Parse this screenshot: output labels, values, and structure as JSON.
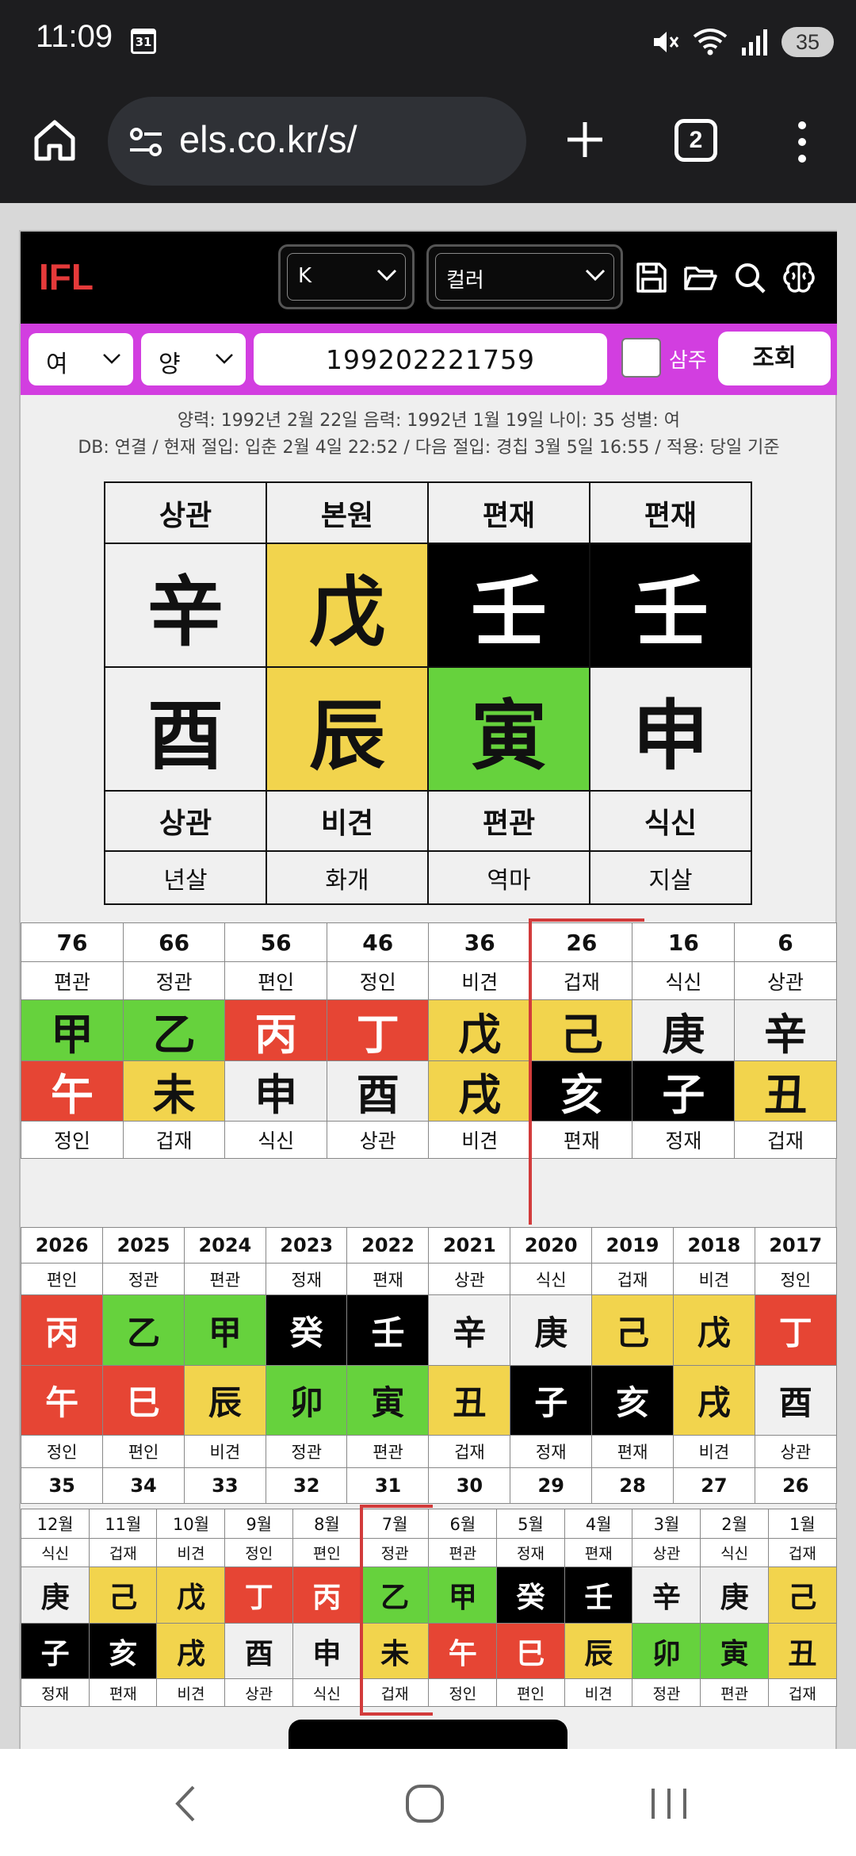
{
  "status": {
    "time": "11:09",
    "calendar_day": "31",
    "battery": "35"
  },
  "browser": {
    "url": "els.co.kr/s/",
    "tab_count": "2"
  },
  "app": {
    "logo": "IFL",
    "select_k": "K",
    "select_color": "컬러",
    "gender": "여",
    "calendar": "양",
    "birth_input": "199202221759",
    "saju_label": "삼주",
    "query_button": "조회",
    "info_line1": "양력: 1992년 2월 22일   음력: 1992년 1월 19일   나이: 35   성별: 여",
    "info_line2": "DB: 연결 / 현재 절입: 입춘 2월 4일 22:52 / 다음 절입: 경칩 3월 5일 16:55 / 적용: 당일 기준"
  },
  "natal": {
    "top": [
      "상관",
      "본원",
      "편재",
      "편재"
    ],
    "stems": [
      {
        "char": "辛",
        "color": "gray"
      },
      {
        "char": "戊",
        "color": "yellow"
      },
      {
        "char": "壬",
        "color": "black"
      },
      {
        "char": "壬",
        "color": "black"
      }
    ],
    "branches": [
      {
        "char": "酉",
        "color": "gray"
      },
      {
        "char": "辰",
        "color": "yellow"
      },
      {
        "char": "寅",
        "color": "green"
      },
      {
        "char": "申",
        "color": "gray"
      }
    ],
    "bottom": [
      "상관",
      "비견",
      "편관",
      "식신"
    ],
    "sal": [
      "년살",
      "화개",
      "역마",
      "지살"
    ]
  },
  "daeun": {
    "ages": [
      "76",
      "66",
      "56",
      "46",
      "36",
      "26",
      "16",
      "6"
    ],
    "top": [
      "편관",
      "정관",
      "편인",
      "정인",
      "비견",
      "겁재",
      "식신",
      "상관"
    ],
    "stems": [
      {
        "char": "甲",
        "color": "green"
      },
      {
        "char": "乙",
        "color": "green"
      },
      {
        "char": "丙",
        "color": "red"
      },
      {
        "char": "丁",
        "color": "red"
      },
      {
        "char": "戊",
        "color": "yellow"
      },
      {
        "char": "己",
        "color": "yellow"
      },
      {
        "char": "庚",
        "color": "gray"
      },
      {
        "char": "辛",
        "color": "gray"
      }
    ],
    "branches": [
      {
        "char": "午",
        "color": "red"
      },
      {
        "char": "未",
        "color": "yellow"
      },
      {
        "char": "申",
        "color": "gray"
      },
      {
        "char": "酉",
        "color": "gray"
      },
      {
        "char": "戌",
        "color": "yellow"
      },
      {
        "char": "亥",
        "color": "black"
      },
      {
        "char": "子",
        "color": "black"
      },
      {
        "char": "丑",
        "color": "yellow"
      }
    ],
    "bottom": [
      "정인",
      "겁재",
      "식신",
      "상관",
      "비견",
      "편재",
      "정재",
      "겁재"
    ]
  },
  "yearly": {
    "years": [
      "2026",
      "2025",
      "2024",
      "2023",
      "2022",
      "2021",
      "2020",
      "2019",
      "2018",
      "2017"
    ],
    "top": [
      "편인",
      "정관",
      "편관",
      "정재",
      "편재",
      "상관",
      "식신",
      "겁재",
      "비견",
      "정인"
    ],
    "stems": [
      {
        "char": "丙",
        "color": "red"
      },
      {
        "char": "乙",
        "color": "green"
      },
      {
        "char": "甲",
        "color": "green"
      },
      {
        "char": "癸",
        "color": "black"
      },
      {
        "char": "壬",
        "color": "black"
      },
      {
        "char": "辛",
        "color": "gray"
      },
      {
        "char": "庚",
        "color": "gray"
      },
      {
        "char": "己",
        "color": "yellow"
      },
      {
        "char": "戊",
        "color": "yellow"
      },
      {
        "char": "丁",
        "color": "red"
      }
    ],
    "branches": [
      {
        "char": "午",
        "color": "red"
      },
      {
        "char": "巳",
        "color": "red"
      },
      {
        "char": "辰",
        "color": "yellow"
      },
      {
        "char": "卯",
        "color": "green"
      },
      {
        "char": "寅",
        "color": "green"
      },
      {
        "char": "丑",
        "color": "yellow"
      },
      {
        "char": "子",
        "color": "black"
      },
      {
        "char": "亥",
        "color": "black"
      },
      {
        "char": "戌",
        "color": "yellow"
      },
      {
        "char": "酉",
        "color": "gray"
      }
    ],
    "bottom": [
      "정인",
      "편인",
      "비견",
      "정관",
      "편관",
      "겁재",
      "정재",
      "편재",
      "비견",
      "상관"
    ],
    "ages": [
      "35",
      "34",
      "33",
      "32",
      "31",
      "30",
      "29",
      "28",
      "27",
      "26"
    ]
  },
  "monthly": {
    "months": [
      "12월",
      "11월",
      "10월",
      "9월",
      "8월",
      "7월",
      "6월",
      "5월",
      "4월",
      "3월",
      "2월",
      "1월"
    ],
    "top": [
      "식신",
      "겁재",
      "비견",
      "정인",
      "편인",
      "정관",
      "편관",
      "정재",
      "편재",
      "상관",
      "식신",
      "겁재"
    ],
    "stems": [
      {
        "char": "庚",
        "color": "gray"
      },
      {
        "char": "己",
        "color": "yellow"
      },
      {
        "char": "戊",
        "color": "yellow"
      },
      {
        "char": "丁",
        "color": "red"
      },
      {
        "char": "丙",
        "color": "red"
      },
      {
        "char": "乙",
        "color": "green"
      },
      {
        "char": "甲",
        "color": "green"
      },
      {
        "char": "癸",
        "color": "black"
      },
      {
        "char": "壬",
        "color": "black"
      },
      {
        "char": "辛",
        "color": "gray"
      },
      {
        "char": "庚",
        "color": "gray"
      },
      {
        "char": "己",
        "color": "yellow"
      }
    ],
    "branches": [
      {
        "char": "子",
        "color": "black"
      },
      {
        "char": "亥",
        "color": "black"
      },
      {
        "char": "戌",
        "color": "yellow"
      },
      {
        "char": "酉",
        "color": "gray"
      },
      {
        "char": "申",
        "color": "gray"
      },
      {
        "char": "未",
        "color": "yellow"
      },
      {
        "char": "午",
        "color": "red"
      },
      {
        "char": "巳",
        "color": "red"
      },
      {
        "char": "辰",
        "color": "yellow"
      },
      {
        "char": "卯",
        "color": "green"
      },
      {
        "char": "寅",
        "color": "green"
      },
      {
        "char": "丑",
        "color": "yellow"
      }
    ],
    "bottom": [
      "정재",
      "편재",
      "비견",
      "상관",
      "식신",
      "겁재",
      "정인",
      "편인",
      "비견",
      "정관",
      "편관",
      "겁재"
    ]
  },
  "theme": {
    "accent": "#d23ee0",
    "marker": "#d23b3b"
  }
}
